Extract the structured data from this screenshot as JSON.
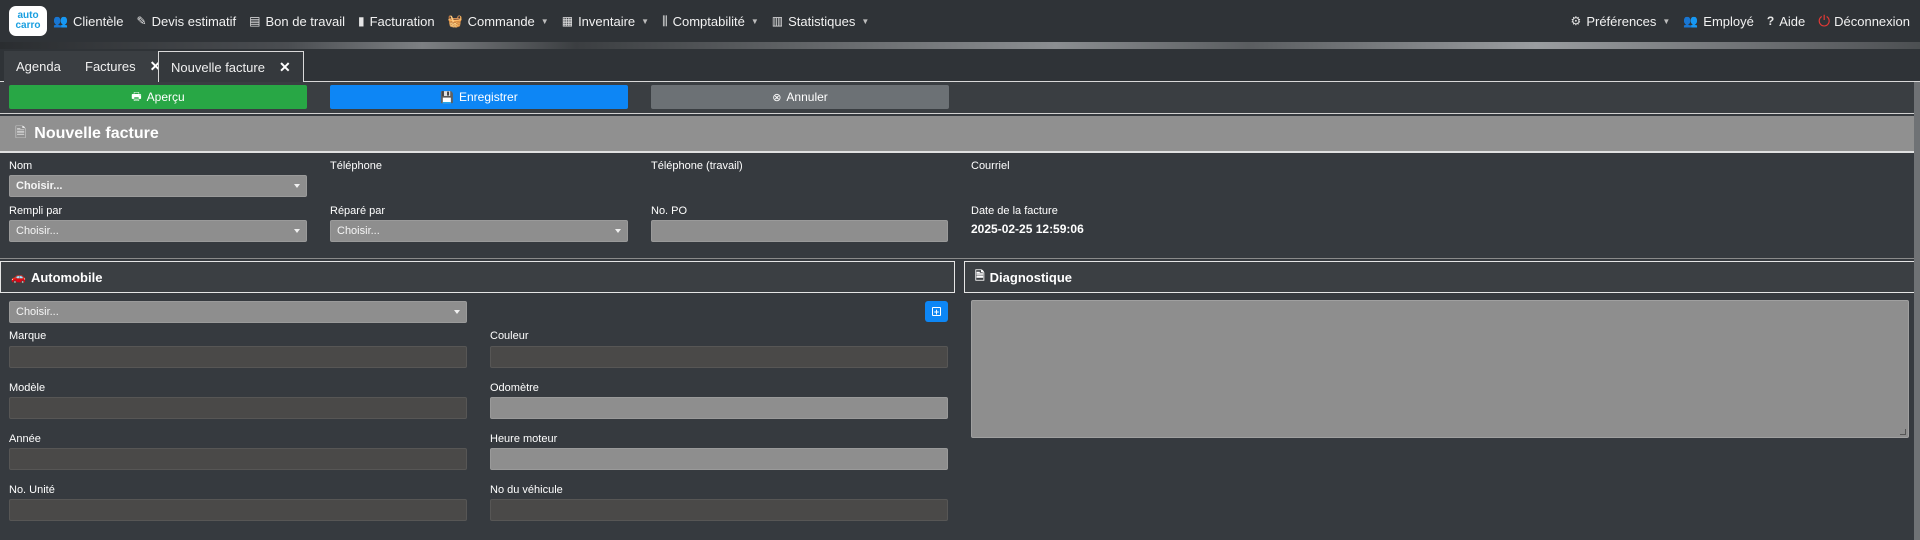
{
  "logo": {
    "line1": "auto",
    "line2": "carro"
  },
  "nav": {
    "left": [
      {
        "label": "Clientèle",
        "icon": "users-icon",
        "glyph": "👥",
        "caret": false
      },
      {
        "label": "Devis estimatif",
        "icon": "edit-icon",
        "glyph": "✎",
        "caret": false
      },
      {
        "label": "Bon de travail",
        "icon": "clipboard-icon",
        "glyph": "▤",
        "caret": false
      },
      {
        "label": "Facturation",
        "icon": "invoice-icon",
        "glyph": "▮",
        "caret": false
      },
      {
        "label": "Commande",
        "icon": "basket-icon",
        "glyph": "🧺",
        "caret": true
      },
      {
        "label": "Inventaire",
        "icon": "boxes-icon",
        "glyph": "▦",
        "caret": true
      },
      {
        "label": "Comptabilité",
        "icon": "bank-icon",
        "glyph": "⫼",
        "caret": true
      },
      {
        "label": "Statistiques",
        "icon": "bar-chart-icon",
        "glyph": "▥",
        "caret": true
      }
    ],
    "right": {
      "preferences": "Préférences",
      "employee": "Employé",
      "help": "Aide",
      "logout": "Déconnexion"
    }
  },
  "tabs": [
    {
      "label": "Agenda",
      "closable": false,
      "active": false
    },
    {
      "label": "Factures",
      "closable": true,
      "active": false
    },
    {
      "label": "Nouvelle facture",
      "closable": true,
      "active": true
    }
  ],
  "actions": {
    "preview": "Aperçu",
    "save": "Enregistrer",
    "cancel": "Annuler"
  },
  "header": {
    "title": "Nouvelle facture"
  },
  "form": {
    "name_label": "Nom",
    "name_value": "Choisir...",
    "phone_label": "Téléphone",
    "work_phone_label": "Téléphone (travail)",
    "email_label": "Courriel",
    "filled_by_label": "Rempli par",
    "filled_by_value": "Choisir...",
    "repaired_by_label": "Réparé par",
    "repaired_by_value": "Choisir...",
    "po_label": "No. PO",
    "date_label": "Date de la facture",
    "date_value": "2025-02-25 12:59:06"
  },
  "automobile": {
    "title": "Automobile",
    "select_value": "Choisir...",
    "make_label": "Marque",
    "color_label": "Couleur",
    "model_label": "Modèle",
    "odometer_label": "Odomètre",
    "year_label": "Année",
    "engine_hours_label": "Heure moteur",
    "unit_label": "No. Unité",
    "vehicle_no_label": "No du véhicule"
  },
  "diagnostic": {
    "title": "Diagnostique"
  },
  "colors": {
    "navbar": "#2f3337",
    "background": "#363a3f",
    "preview_button": "#28a745",
    "save_button": "#0d86f5",
    "cancel_button": "#6c7175",
    "input": "#8e8e8e",
    "logout_icon": "#e53935"
  }
}
